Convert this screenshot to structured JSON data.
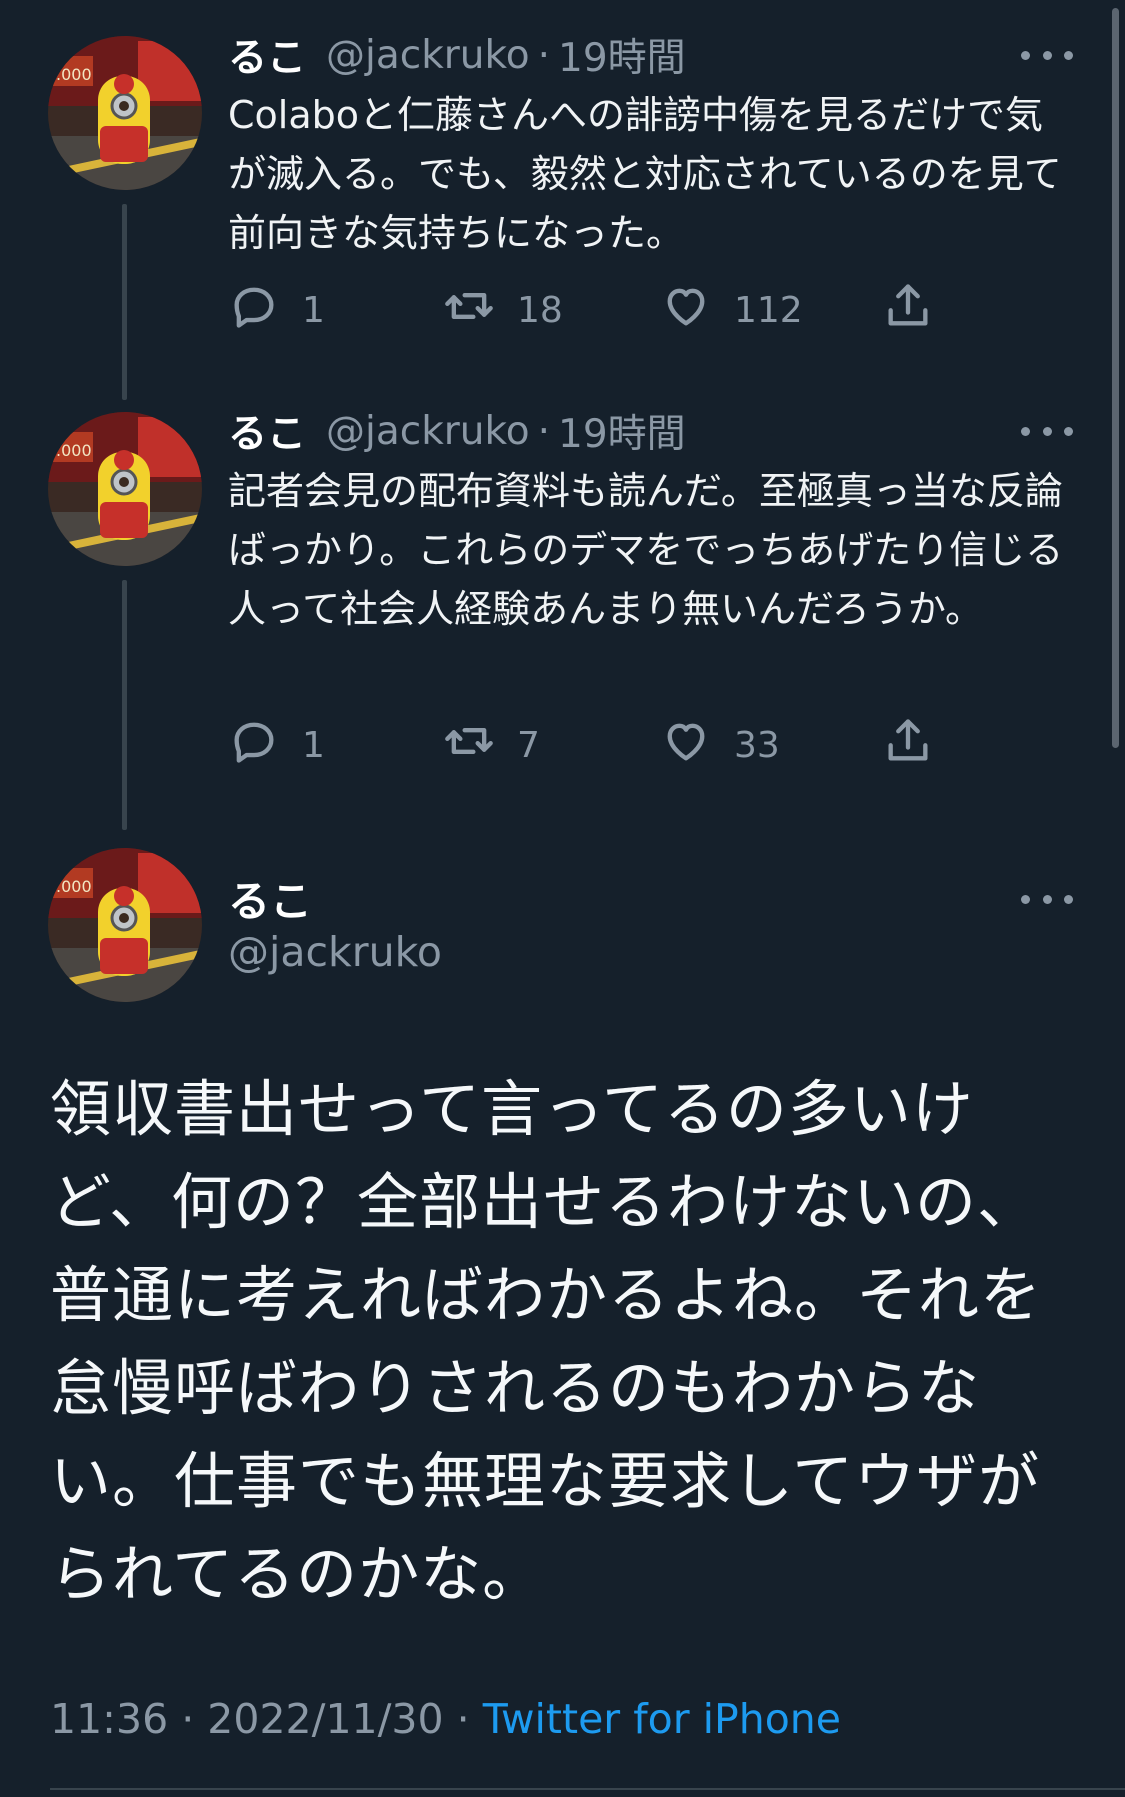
{
  "tweets": [
    {
      "name": "るこ",
      "handle": "@jackruko",
      "separator": "·",
      "time": "19時間",
      "text": "Colaboと仁藤さんへの誹謗中傷を見るだけで気が滅入る。でも、毅然と対応されているのを見て前向きな気持ちになった。",
      "replies": "1",
      "retweets": "18",
      "likes": "112"
    },
    {
      "name": "るこ",
      "handle": "@jackruko",
      "separator": "·",
      "time": "19時間",
      "text": "記者会見の配布資料も読んだ。至極真っ当な反論ばっかり。これらのデマをでっちあげたり信じる人って社会人経験あんまり無いんだろうか。",
      "replies": "1",
      "retweets": "7",
      "likes": "33"
    }
  ],
  "main_tweet": {
    "name": "るこ",
    "handle": "@jackruko",
    "text": "領収書出せって言ってるの多いけど、何の？全部出せるわけないの、普通に考えればわかるよね。それを怠慢呼ばわりされるのもわからない。仕事でも無理な要求してウザがられてるのかな。",
    "time": "11:36",
    "separator": "·",
    "date": "2022/11/30",
    "source": "Twitter for iPhone"
  },
  "icons": {
    "reply": "reply-icon",
    "retweet": "retweet-icon",
    "like": "heart-icon",
    "share": "share-icon",
    "more": "more-icon"
  },
  "colors": {
    "background": "#15202b",
    "secondary_text": "#8b98a5",
    "link": "#1d9bf0",
    "thread_line": "#38444d"
  }
}
